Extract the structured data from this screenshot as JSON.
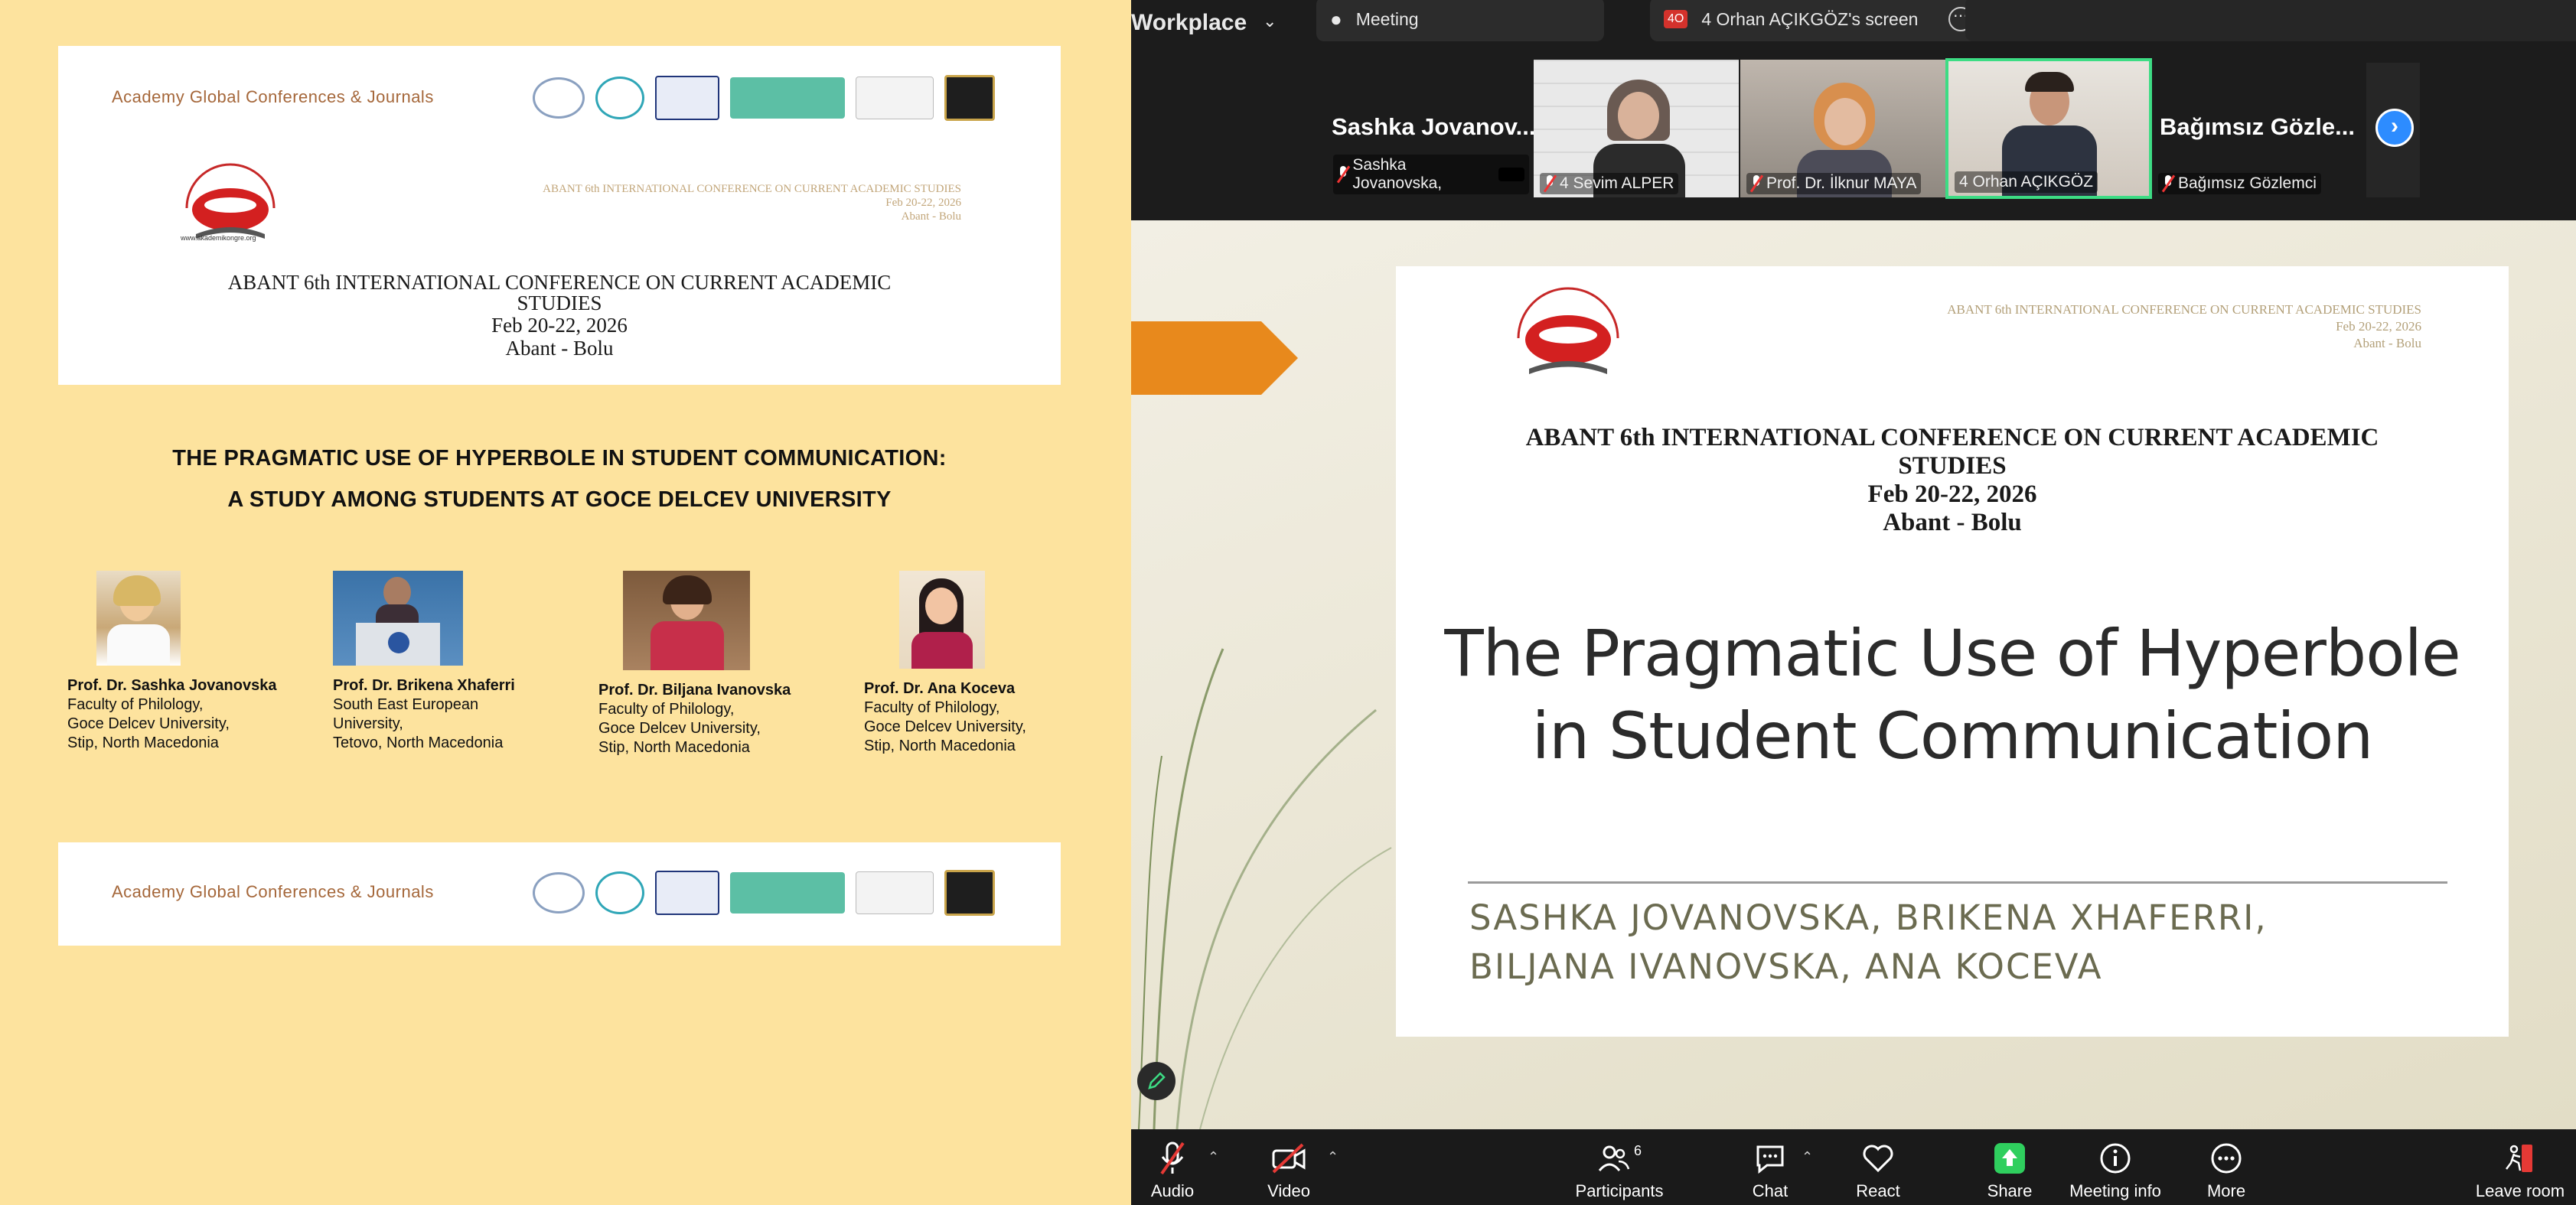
{
  "poster": {
    "banner_name": "Academy  Global Conferences & Journals",
    "seal_url": "www.akademikongre.org",
    "mini_conf": {
      "line1": "ABANT  6th INTERNATIONAL CONFERENCE ON CURRENT ACADEMIC STUDIES",
      "line2": "Feb 20-22, 2026",
      "line3": "Abant - Bolu"
    },
    "conference": {
      "line1": "ABANT  6th INTERNATIONAL CONFERENCE ON CURRENT ACADEMIC",
      "line2": "STUDIES",
      "line3": "Feb 20-22, 2026",
      "line4": "Abant - Bolu"
    },
    "paper_title_line1": "THE PRAGMATIC USE OF HYPERBOLE IN STUDENT COMMUNICATION:",
    "paper_title_line2": "A STUDY AMONG STUDENTS AT GOCE DELCEV UNIVERSITY",
    "authors": [
      {
        "name": "Prof. Dr. Sashka Jovanovska",
        "affiliation": "Faculty of Philology,\nGoce Delcev University,\nStip, North Macedonia"
      },
      {
        "name": "Prof. Dr. Brikena Xhaferri",
        "affiliation": "South East European\nUniversity,\nTetovo, North Macedonia"
      },
      {
        "name": "Prof. Dr. Biljana Ivanovska",
        "affiliation": "Faculty of Philology,\nGoce Delcev University,\nStip, North Macedonia"
      },
      {
        "name": "Prof. Dr. Ana Koceva",
        "affiliation": "Faculty of Philology,\nGoce Delcev University,\nStip, North Macedonia"
      }
    ]
  },
  "zoom": {
    "app_title": "Workplace",
    "meeting_label": "Meeting",
    "screen_share_badge": "4O",
    "screen_share_label": "4 Orhan AÇIKGÖZ's screen",
    "participants_strip": {
      "left_name": "Sashka  Jovanov...",
      "right_name": "Bağımsız  Gözle...",
      "tiles": [
        {
          "label": "Sashka Jovanovska,"
        },
        {
          "label": "4 Sevim ALPER"
        },
        {
          "label": "Prof. Dr. İlknur MAYA"
        },
        {
          "label": "4 Orhan AÇIKGÖZ"
        },
        {
          "label": "Bağımsız Gözlemci"
        }
      ]
    },
    "slide": {
      "mini_line1": "ABANT  6th INTERNATIONAL CONFERENCE ON CURRENT ACADEMIC STUDIES",
      "mini_line2": "Feb 20-22, 2026",
      "mini_line3": "Abant - Bolu",
      "conf_line1": "ABANT  6th INTERNATIONAL CONFERENCE ON CURRENT ACADEMIC",
      "conf_line2": "STUDIES",
      "conf_line3": "Feb 20-22, 2026",
      "conf_line4": "Abant - Bolu",
      "title_line1": "The Pragmatic Use of Hyperbole",
      "title_line2": "in Student Communication",
      "authors_line1": "SASHKA JOVANOVSKA, BRIKENA XHAFERRI,",
      "authors_line2": "BILJANA IVANOVSKA, ANA KOCEVA"
    },
    "controls": {
      "audio": "Audio",
      "video": "Video",
      "participants": "Participants",
      "participants_count": "6",
      "chat": "Chat",
      "react": "React",
      "share": "Share",
      "meeting_info": "Meeting info",
      "more": "More",
      "leave": "Leave room"
    },
    "colors": {
      "share_green": "#2fcf5e",
      "active_tile_border": "#3ddc84",
      "nav_blue": "#2d8cff",
      "leave_red": "#e53935"
    }
  }
}
